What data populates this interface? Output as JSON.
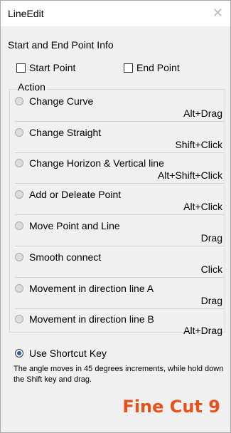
{
  "window": {
    "title": "LineEdit",
    "close_glyph": "✕"
  },
  "start_end": {
    "label": "Start and End Point Info",
    "start_point": "Start Point",
    "end_point": "End Point"
  },
  "action": {
    "title": "Action",
    "items": [
      {
        "label": "Change Curve",
        "shortcut": "Alt+Drag"
      },
      {
        "label": "Change Straight",
        "shortcut": "Shift+Click"
      },
      {
        "label": "Change Horizon & Vertical line",
        "shortcut": "Alt+Shift+Click"
      },
      {
        "label": "Add or Deleate Point",
        "shortcut": "Alt+Click"
      },
      {
        "label": "Move Point and Line",
        "shortcut": "Drag"
      },
      {
        "label": "Smooth connect",
        "shortcut": "Click"
      },
      {
        "label": "Movement in direction line A",
        "shortcut": "Drag"
      },
      {
        "label": "Movement in direction line B",
        "shortcut": "Alt+Drag"
      }
    ]
  },
  "shortcut": {
    "label": "Use Shortcut Key",
    "note": "The angle moves in 45 degrees increments, while hold down the Shift key and drag."
  },
  "logo": {
    "text": "Fine Cut 9",
    "color": "#e6521a"
  }
}
